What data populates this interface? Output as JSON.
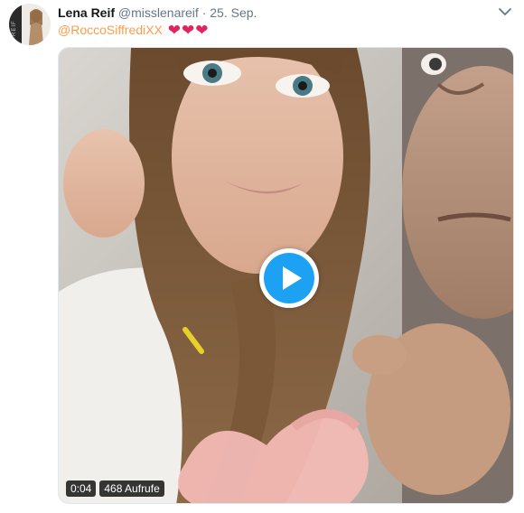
{
  "tweet": {
    "author_name": "Lena Reif",
    "handle": "@misslenareif",
    "separator": "·",
    "date": "25. Sep.",
    "mention": "@RoccoSiffrediXX",
    "hearts": "❤❤❤",
    "avatar_icon": "avatar-photo",
    "menu_icon": "chevron-down-icon"
  },
  "video": {
    "duration": "0:04",
    "views": "468 Aufrufe",
    "play_icon": "play-icon"
  },
  "colors": {
    "mention": "#ff9c49",
    "accent": "#1da1f2",
    "heart": "#e0245e",
    "secondary_text": "#657786"
  }
}
